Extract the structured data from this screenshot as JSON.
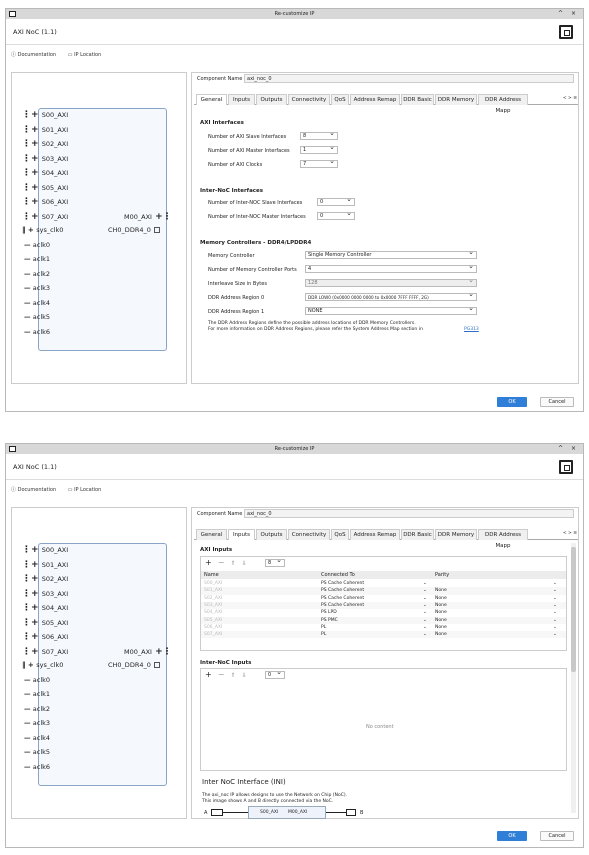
{
  "window_title": "Re-customize IP",
  "window_controls": "^ ×",
  "ip_name": "AXI NoC (1.1)",
  "links": {
    "documentation": "Documentation",
    "ip_location": "IP Location"
  },
  "component_name_label": "Component Name",
  "component_name_value": "axi_noc_0",
  "tabs": [
    "General",
    "Inputs",
    "Outputs",
    "Connectivity",
    "QoS",
    "Address Remap",
    "DDR Basic",
    "DDR Memory",
    "DDR Address Mapp"
  ],
  "tab_scroll": "< > ≡",
  "block": {
    "left_ports": [
      "S00_AXI",
      "S01_AXI",
      "S02_AXI",
      "S03_AXI",
      "S04_AXI",
      "S05_AXI",
      "S06_AXI",
      "S07_AXI",
      "sys_clk0"
    ],
    "clocks": [
      "aclk0",
      "aclk1",
      "aclk2",
      "aclk3",
      "aclk4",
      "aclk5",
      "aclk6"
    ],
    "right_ports": [
      "M00_AXI",
      "CH0_DDR4_0"
    ]
  },
  "general": {
    "axi_interfaces": "AXI Interfaces",
    "slave_label": "Number of AXI Slave Interfaces",
    "slave_value": "8",
    "master_label": "Number of AXI Master Interfaces",
    "master_value": "1",
    "clocks_label": "Number of AXI Clocks",
    "clocks_value": "7",
    "inter_noc": "Inter-NoC Interfaces",
    "ini_slave_label": "Number of Inter-NOC Slave Interfaces",
    "ini_slave_value": "0",
    "ini_master_label": "Number of Inter-NOC Master Interfaces",
    "ini_master_value": "0",
    "mem_ctrl": "Memory Controllers - DDR4/LPDDR4",
    "memctrl_label": "Memory Controller",
    "memctrl_value": "Single Memory Controller",
    "ports_label": "Number of Memory Controller Ports",
    "ports_value": "4",
    "interleave_label": "Interleave Size in Bytes",
    "interleave_value": "128",
    "region0_label": "DDR Address Region 0",
    "region0_value": "DDR LOW0 (0x0000 0000 0000 to 0x0000 7FFF FFFF, 2G)",
    "region1_label": "DDR Address Region 1",
    "region1_value": "NONE",
    "note1": "The DDR Address Regions define the possible address locations of DDR Memory Controllers.",
    "note2": "For more information on DDR Address Regions, please refer the System Address Map section in",
    "note_link": "PG313"
  },
  "inputs": {
    "axi_inputs": "AXI Inputs",
    "count": "8",
    "count2": "0",
    "col_name": "Name",
    "col_connected": "Connected To",
    "col_parity": "Parity",
    "rows": [
      {
        "name": "S00_AXI",
        "conn": "PS Cache Coherent",
        "parity": ""
      },
      {
        "name": "S01_AXI",
        "conn": "PS Cache Coherent",
        "parity": "None"
      },
      {
        "name": "S02_AXI",
        "conn": "PS Cache Coherent",
        "parity": "None"
      },
      {
        "name": "S03_AXI",
        "conn": "PS Cache Coherent",
        "parity": "None"
      },
      {
        "name": "S04_AXI",
        "conn": "PS LPD",
        "parity": "None"
      },
      {
        "name": "S05_AXI",
        "conn": "PS PMC",
        "parity": "None"
      },
      {
        "name": "S06_AXI",
        "conn": "PL",
        "parity": "None"
      },
      {
        "name": "S07_AXI",
        "conn": "PL",
        "parity": "None"
      }
    ],
    "inter_noc_inputs": "Inter-NoC Inputs",
    "no_content": "No content",
    "ini_heading": "Inter NoC Interface (INI)",
    "ini_text1": "The axi_noc IP allows designs to use the Network on Chip (NoC).",
    "ini_text2": "This image shows A and B directly connected via the NoC.",
    "diag_a": "A",
    "diag_b": "B",
    "diag_s": "S00_AXI",
    "diag_m": "M00_AXI"
  },
  "ok": "OK",
  "cancel": "Cancel"
}
